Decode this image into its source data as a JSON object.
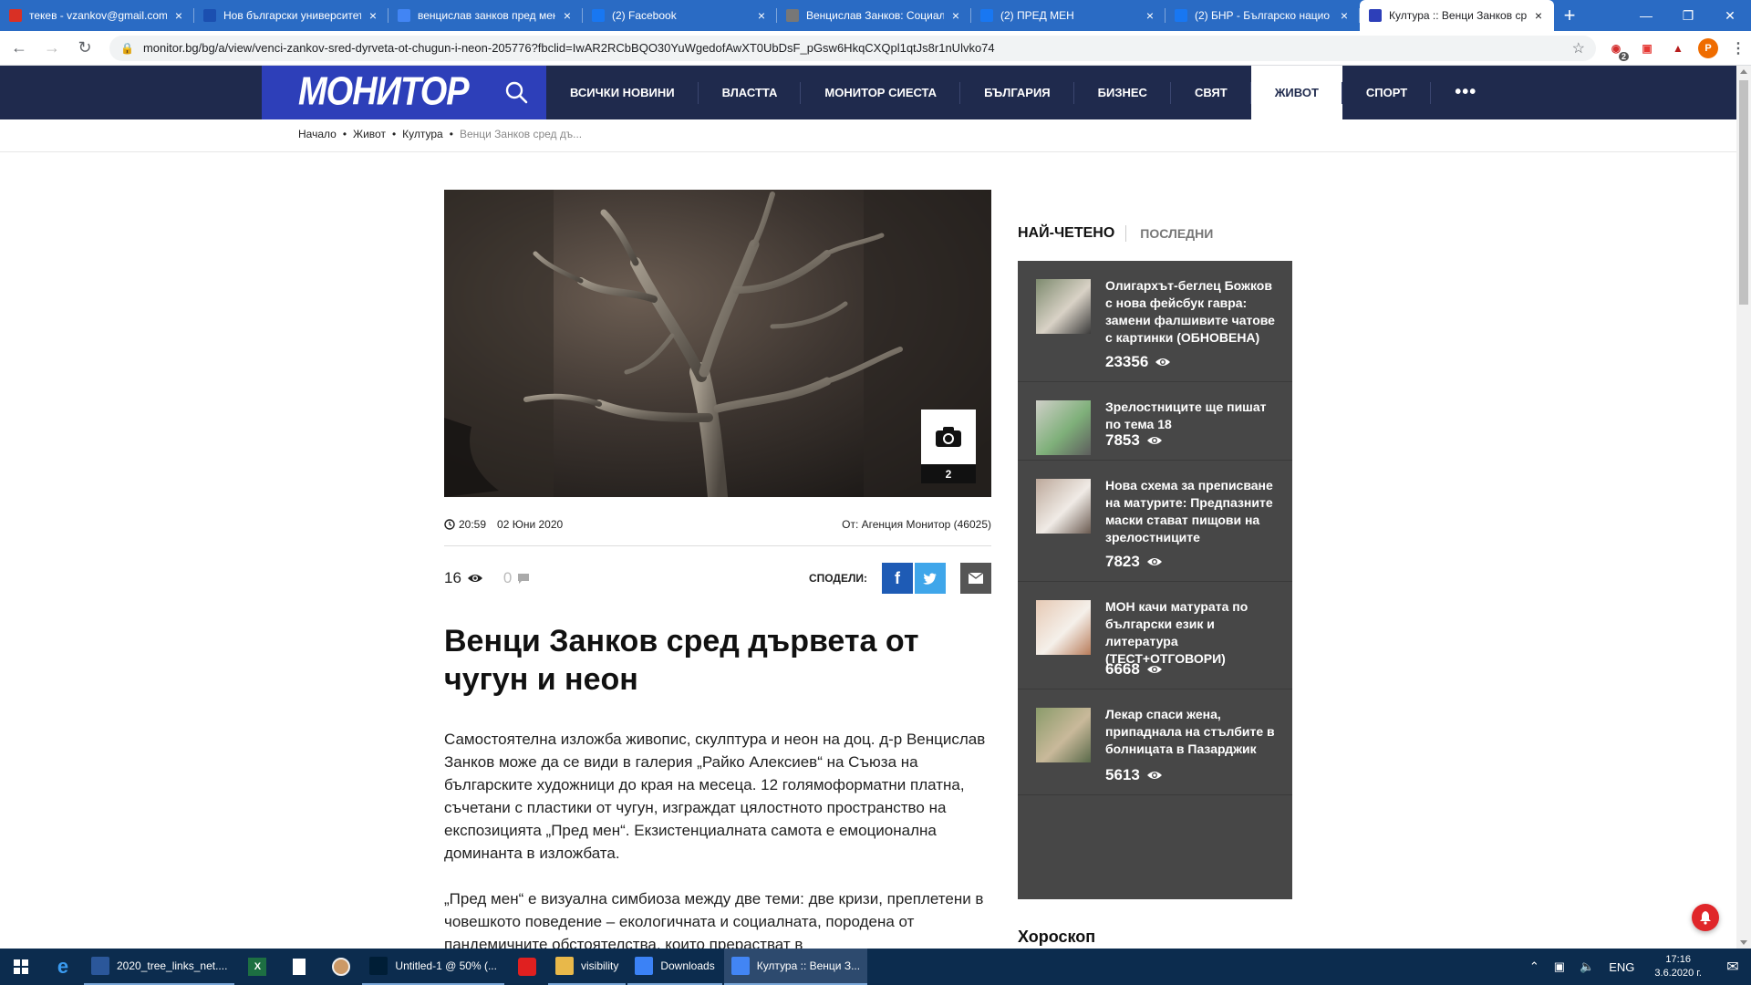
{
  "browser": {
    "tabs": [
      {
        "title": "текев - vzankov@gmail.com",
        "favicon": "gmail-icon",
        "color": "#d93025",
        "active": false
      },
      {
        "title": "Нов български университет",
        "favicon": "nbu-icon",
        "color": "#1b4fb0",
        "active": false
      },
      {
        "title": "венцислав занков пред мен",
        "favicon": "google-icon",
        "color": "#4285f4",
        "active": false
      },
      {
        "title": "(2) Facebook",
        "favicon": "facebook-icon",
        "color": "#1877f2",
        "active": false
      },
      {
        "title": "Венцислав Занков: Социал",
        "favicon": "site-icon",
        "color": "#777777",
        "active": false
      },
      {
        "title": "(2) ПРЕД МЕН",
        "favicon": "facebook-icon",
        "color": "#1877f2",
        "active": false
      },
      {
        "title": "(2) БНР - Българско нацио",
        "favicon": "facebook-icon",
        "color": "#1877f2",
        "active": false
      },
      {
        "title": "Култура :: Венци Занков ср",
        "favicon": "monitor-icon",
        "color": "#2d3fb9",
        "active": true
      }
    ],
    "new_tab": "+",
    "url": "monitor.bg/bg/a/view/venci-zankov-sred-dyrveta-ot-chugun-i-neon-205776?fbclid=IwAR2RCbBQO30YuWgedofAwXT0UbDsF_pGsw6HkqCXQpl1qtJs8r1nUlvko74",
    "ext_badge": "2",
    "profile_initial": "P"
  },
  "site": {
    "logo": "МОНИТОР",
    "menu": [
      {
        "label": "ВСИЧКИ НОВИНИ",
        "active": false
      },
      {
        "label": "ВЛАСТТА",
        "active": false
      },
      {
        "label": "МОНИТОР СИЕСТА",
        "active": false
      },
      {
        "label": "БЪЛГАРИЯ",
        "active": false
      },
      {
        "label": "БИЗНЕС",
        "active": false
      },
      {
        "label": "СВЯТ",
        "active": false
      },
      {
        "label": "ЖИВОТ",
        "active": true
      },
      {
        "label": "СПОРТ",
        "active": false
      }
    ],
    "more": "•••",
    "brand_color": "#2d3fb9",
    "nav_color": "#1f2a4d"
  },
  "breadcrumb": [
    "Начало",
    "Живот",
    "Култура",
    "Венци Занков сред дъ..."
  ],
  "article": {
    "gallery_count": "2",
    "time": "20:59",
    "date": "02 Юни 2020",
    "source": "От: Агенция Монитор (46025)",
    "views": "16",
    "comments": "0",
    "share_label": "СПОДЕЛИ:",
    "headline": "Венци Занков сред дървета от чугун и неон",
    "p1": "Самостоятелна изложба живопис, скулптура и неон на доц. д-р Венцислав Занков може да се види в галерия „Райко Алексиев“ на Съюза на българските художници до края на месеца. 12 голямоформатни платна, съчетани с пластики от чугун, изграждат цялостното пространство на експозицията „Пред мен“. Екзистенциалната самота е емоционална доминанта в изложбата.",
    "p2": "„Пред мен“ е визуална симбиоза между две теми: две кризи, преплетени в човешкото поведение – екологичната и социалната, породена от пандемичните обстоятелства, които прерастват в"
  },
  "sidebar": {
    "tab_most_read": "НАЙ-ЧЕТЕНО",
    "tab_latest": "ПОСЛЕДНИ",
    "items": [
      {
        "title": "Олигархът-беглец Божков с нова фейсбук гавра: замени фалшивите чатове с картинки (ОБНОВЕНА)",
        "views": "23356"
      },
      {
        "title": "Зрелостниците ще пишат по тема 18",
        "views": "7853"
      },
      {
        "title": "Нова схема за преписване на матурите: Предпазните маски стават пищови на зрелостниците",
        "views": "7823"
      },
      {
        "title": "МОН качи матурата по български език и литература (ТЕСТ+ОТГОВОРИ)",
        "views": "6668"
      },
      {
        "title": "Лекар спаси жена, припаднала на стълбите в болницата в Пазарджик",
        "views": "5613"
      }
    ],
    "horoscope": "Хороскоп"
  },
  "taskbar": {
    "apps": [
      {
        "label": "2020_tree_links_net....",
        "icon": "word-icon",
        "color": "#2b579a",
        "active": false
      },
      {
        "label": "Untitled-1 @ 50% (...",
        "icon": "photoshop-icon",
        "color": "#001e36",
        "active": false
      },
      {
        "label": "visibility",
        "icon": "folder-icon",
        "color": "#e8b84a",
        "active": false
      },
      {
        "label": "Downloads",
        "icon": "download-icon",
        "color": "#3b82f6",
        "active": false
      },
      {
        "label": "Култура :: Венци З...",
        "icon": "chrome-icon",
        "color": "#4285f4",
        "active": true
      }
    ],
    "lang": "ENG",
    "time": "17:16",
    "date": "3.6.2020 г."
  }
}
